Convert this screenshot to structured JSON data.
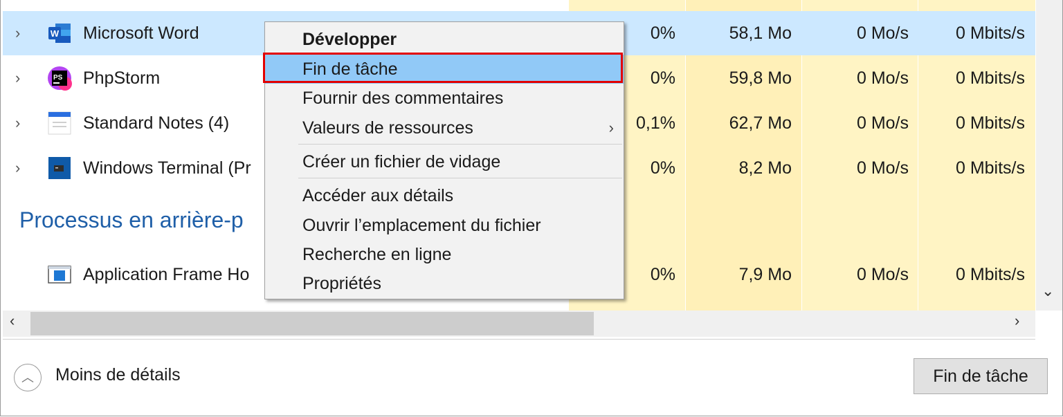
{
  "rows": [
    {
      "name": "Microsoft Word",
      "cpu": "0%",
      "memory": "58,1 Mo",
      "disk": "0 Mo/s",
      "network": "0 Mbits/s",
      "icon": "word-icon",
      "chevron": "›"
    },
    {
      "name": "PhpStorm",
      "cpu": "0%",
      "memory": "59,8 Mo",
      "disk": "0 Mo/s",
      "network": "0 Mbits/s",
      "icon": "phpstorm-icon",
      "chevron": "›"
    },
    {
      "name": "Standard Notes (4)",
      "cpu": "0,1%",
      "memory": "62,7 Mo",
      "disk": "0 Mo/s",
      "network": "0 Mbits/s",
      "icon": "standard-notes-icon",
      "chevron": "›"
    },
    {
      "name": "Windows Terminal (Pr",
      "cpu": "0%",
      "memory": "8,2 Mo",
      "disk": "0 Mo/s",
      "network": "0 Mbits/s",
      "icon": "terminal-icon",
      "chevron": "›"
    }
  ],
  "section": {
    "title": "Processus en arrière-p"
  },
  "background_rows": [
    {
      "name": "Application Frame Ho",
      "cpu": "0%",
      "memory": "7,9 Mo",
      "disk": "0 Mo/s",
      "network": "0 Mbits/s",
      "icon": "app-frame-icon"
    }
  ],
  "context_menu": {
    "items": [
      {
        "label": "Développer",
        "bold": true
      },
      {
        "label": "Fin de tâche",
        "highlighted": true
      },
      {
        "label": "Fournir des commentaires"
      },
      {
        "label": "Valeurs de ressources",
        "submenu": true
      },
      {
        "label": "Créer un fichier de vidage"
      },
      {
        "label": "Accéder aux détails"
      },
      {
        "label": "Ouvrir l’emplacement du fichier"
      },
      {
        "label": "Recherche en ligne"
      },
      {
        "label": "Propriétés"
      }
    ],
    "submenu_arrow": "›"
  },
  "footer": {
    "less_details": "Moins de détails",
    "less_details_icon": "︿",
    "end_task_button": "Fin de tâche"
  },
  "scrollbar": {
    "left_arrow": "‹",
    "right_arrow": "›",
    "down_arrow": "⌄"
  },
  "colors": {
    "selected_row": "#cce8ff",
    "cpu_column": "#fff4c4",
    "other_columns": "#fff9d6",
    "highlight_box": "#e30000",
    "menu_highlight": "#91c9f7"
  }
}
